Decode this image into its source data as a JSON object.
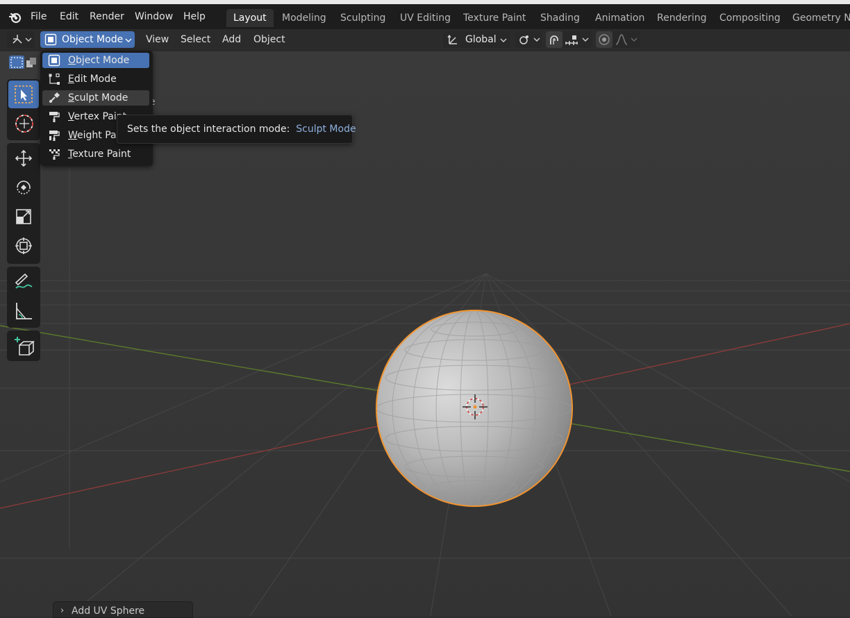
{
  "app": {
    "menu": [
      "File",
      "Edit",
      "Render",
      "Window",
      "Help"
    ]
  },
  "workspace_tabs": [
    {
      "label": "Layout",
      "active": true
    },
    {
      "label": "Modeling",
      "active": false
    },
    {
      "label": "Sculpting",
      "active": false
    },
    {
      "label": "UV Editing",
      "active": false
    },
    {
      "label": "Texture Paint",
      "active": false
    },
    {
      "label": "Shading",
      "active": false
    },
    {
      "label": "Animation",
      "active": false
    },
    {
      "label": "Rendering",
      "active": false
    },
    {
      "label": "Compositing",
      "active": false
    },
    {
      "label": "Geometry Nodes",
      "active": false
    }
  ],
  "header": {
    "editor_type_icon": "3d-viewport-icon",
    "mode_label": "Object Mode",
    "menus": [
      "View",
      "Select",
      "Add",
      "Object"
    ],
    "orientation_label": "Global"
  },
  "mode_dropdown": {
    "items": [
      {
        "underline": "O",
        "rest": "bject Mode",
        "icon": "object-mode-icon",
        "state": "selected"
      },
      {
        "underline": "E",
        "rest": "dit Mode",
        "icon": "edit-mode-icon",
        "state": ""
      },
      {
        "underline": "S",
        "rest": "culpt Mode",
        "icon": "sculpt-mode-icon",
        "state": "hover"
      },
      {
        "underline": "V",
        "rest": "ertex Paint",
        "icon": "vertex-paint-icon",
        "state": ""
      },
      {
        "underline": "W",
        "rest": "eight Paint",
        "icon": "weight-paint-icon",
        "state": ""
      },
      {
        "underline": "T",
        "rest": "exture Paint",
        "icon": "texture-paint-icon",
        "state": ""
      }
    ]
  },
  "tooltip": {
    "text": "Sets the object interaction mode:",
    "value": "Sculpt Mode"
  },
  "viewport": {
    "overlay_fragment": "e"
  },
  "redo_panel": {
    "label": "Add UV Sphere"
  },
  "colors": {
    "accent": "#4772b3",
    "selection_outline": "#f0932f",
    "x_axis": "#8a3a3a",
    "y_axis": "#5d7a2c"
  }
}
